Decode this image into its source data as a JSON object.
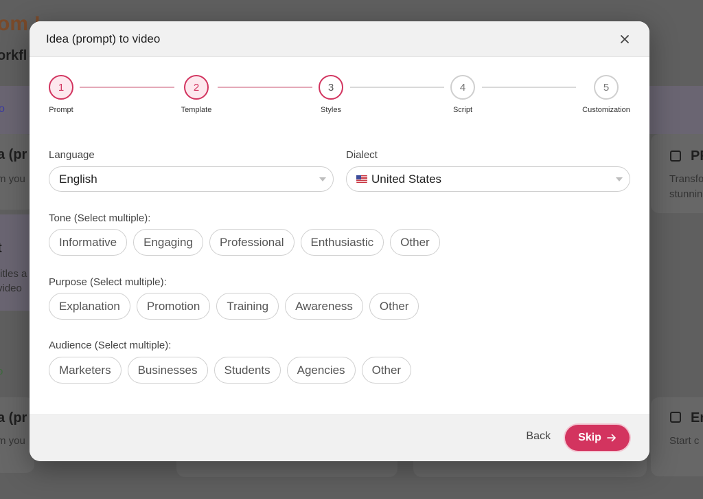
{
  "modal": {
    "title": "Idea (prompt) to video",
    "close_icon": "close-icon"
  },
  "stepper": {
    "steps": [
      {
        "number": "1",
        "label": "Prompt",
        "state": "done"
      },
      {
        "number": "2",
        "label": "Template",
        "state": "done"
      },
      {
        "number": "3",
        "label": "Styles",
        "state": "active"
      },
      {
        "number": "4",
        "label": "Script",
        "state": "todo"
      },
      {
        "number": "5",
        "label": "Customization",
        "state": "todo"
      }
    ]
  },
  "language": {
    "label": "Language",
    "value": "English"
  },
  "dialect": {
    "label": "Dialect",
    "value": "United States",
    "flag_icon": "us-flag-icon"
  },
  "tone": {
    "label": "Tone (Select multiple):",
    "options": [
      "Informative",
      "Engaging",
      "Professional",
      "Enthusiastic",
      "Other"
    ]
  },
  "purpose": {
    "label": "Purpose (Select multiple):",
    "options": [
      "Explanation",
      "Promotion",
      "Training",
      "Awareness",
      "Other"
    ]
  },
  "audience": {
    "label": "Audience (Select multiple):",
    "options": [
      "Marketers",
      "Businesses",
      "Students",
      "Agencies",
      "Other"
    ]
  },
  "footer": {
    "back_label": "Back",
    "skip_label": "Skip",
    "skip_icon": "arrow-right-icon"
  },
  "colors": {
    "accent": "#d3345f",
    "accent_light": "#fde8ee",
    "border": "#cfcfcf"
  },
  "background": {
    "heading": "om !",
    "subheading": "orkfl",
    "card_left_top_title": "a (pr",
    "card_left_top_sub": "m you",
    "card_left_mid_title": "t",
    "card_left_mid_sub_1": "titles a",
    "card_left_mid_sub_2": "video",
    "card_left_low_letter": "o",
    "card_left_bottom_title": "a (pr",
    "card_left_bottom_sub": "m you",
    "card_right_top_title": "PF",
    "card_right_top_sub_1": "Transfo",
    "card_right_top_sub_2": "stunnin",
    "card_right_bottom_title": "En",
    "card_right_bottom_sub": "Start c",
    "card_left_top_letter": "o"
  }
}
